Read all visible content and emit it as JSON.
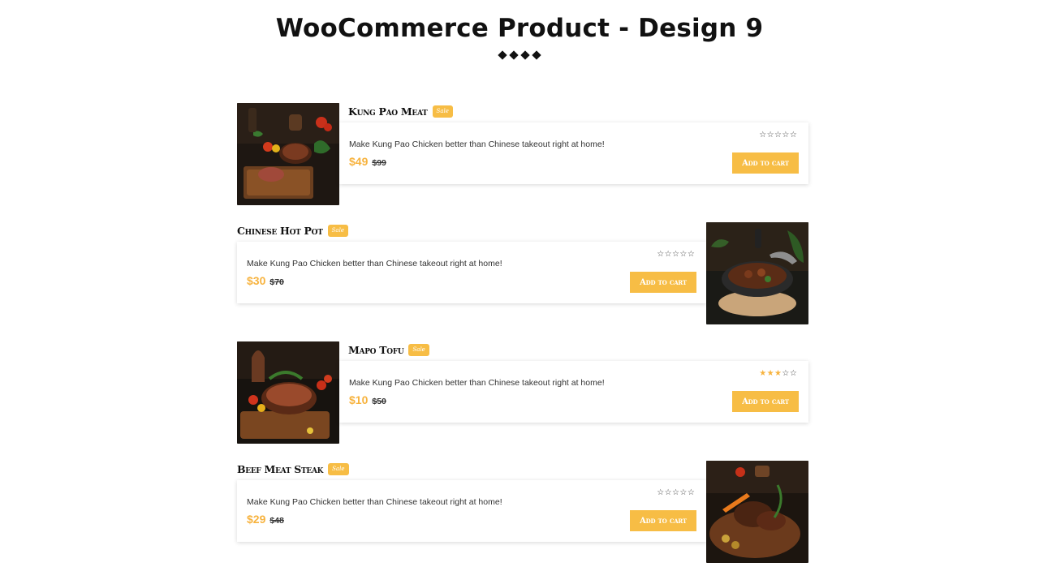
{
  "header": {
    "title": "WooCommerce Product - Design 9"
  },
  "products": [
    {
      "name": "Kung Pao Meat",
      "badge": "Sale",
      "description": "Make Kung Pao Chicken better than Chinese takeout right at home!",
      "price": "$49",
      "old_price": "$99",
      "rating": 0,
      "button_label": "Add to cart",
      "image": "grilled-steak-on-board"
    },
    {
      "name": "Chinese Hot Pot",
      "badge": "Sale",
      "description": "Make Kung Pao Chicken better than Chinese takeout right at home!",
      "price": "$30",
      "old_price": "$70",
      "rating": 0,
      "button_label": "Add to cart",
      "image": "hot-pot-in-pan"
    },
    {
      "name": "Mapo Tofu",
      "badge": "Sale",
      "description": "Make Kung Pao Chicken better than Chinese takeout right at home!",
      "price": "$10",
      "old_price": "$50",
      "rating": 3,
      "button_label": "Add to cart",
      "image": "roast-meat-with-vegetables"
    },
    {
      "name": "Beef Meat Steak",
      "badge": "Sale",
      "description": "Make Kung Pao Chicken better than Chinese takeout right at home!",
      "price": "$29",
      "old_price": "$48",
      "rating": 0,
      "button_label": "Add to cart",
      "image": "beef-steak-with-carrots"
    }
  ],
  "colors": {
    "accent": "#f7bd45",
    "price": "#f7b33f",
    "title": "#111111"
  }
}
